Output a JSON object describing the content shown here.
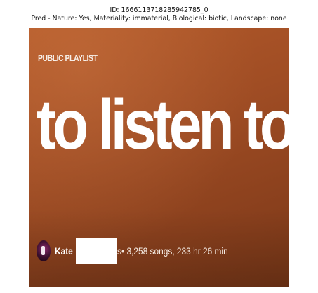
{
  "caption": {
    "id_line": "ID: 1666113718285942785_0",
    "pred_line": "Pred - Nature: Yes, Materiality: immaterial, Biological: biotic, Landscape: none"
  },
  "playlist": {
    "type_label": "PUBLIC PLAYLIST",
    "title": "to listen to",
    "owner_name": "Kate",
    "owner_suffix": "s",
    "stats": "• 3,258 songs, 233 hr 26 min"
  },
  "colors": {
    "background_accent": "#a04d24",
    "title_text": "#ffffff",
    "redaction": "#ffffff"
  },
  "icons": {
    "avatar": "user-avatar"
  }
}
